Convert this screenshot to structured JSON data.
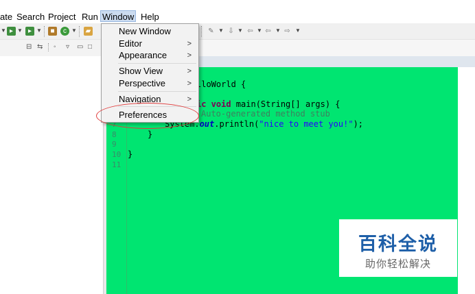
{
  "menubar": {
    "items": [
      {
        "label": "ate"
      },
      {
        "label": "Search"
      },
      {
        "label": "Project"
      },
      {
        "label": "Run"
      },
      {
        "label": "Window"
      },
      {
        "label": "Help"
      }
    ]
  },
  "window_menu": {
    "items": [
      {
        "label": "New Window",
        "submenu": false
      },
      {
        "label": "Editor",
        "submenu": true
      },
      {
        "label": "Appearance",
        "submenu": true
      },
      {
        "label": "Show View",
        "submenu": true
      },
      {
        "label": "Perspective",
        "submenu": true
      },
      {
        "label": "Navigation",
        "submenu": true
      },
      {
        "label": "Preferences",
        "submenu": false
      }
    ],
    "submenu_arrow": ">"
  },
  "editor": {
    "background": "#00e571",
    "lines": [
      {
        "num": "",
        "code": "lloWorld {"
      },
      {
        "num": "",
        "code": "ic void main(String[] args) {"
      },
      {
        "num": "",
        "code": "Auto-generated method stub"
      },
      {
        "num": "7",
        "code": "System.out.println(\"nice to meet you!\");"
      },
      {
        "num": "8",
        "code": "}"
      },
      {
        "num": "9",
        "code": ""
      },
      {
        "num": "10",
        "code": "}"
      },
      {
        "num": "11",
        "code": ""
      }
    ]
  },
  "watermark": {
    "title": "百科全说",
    "subtitle": "助你轻松解决"
  },
  "colors": {
    "annotation": "#e03a3a",
    "menu_highlight": "#ccdcf0",
    "watermark_blue": "#1e5fa8"
  }
}
